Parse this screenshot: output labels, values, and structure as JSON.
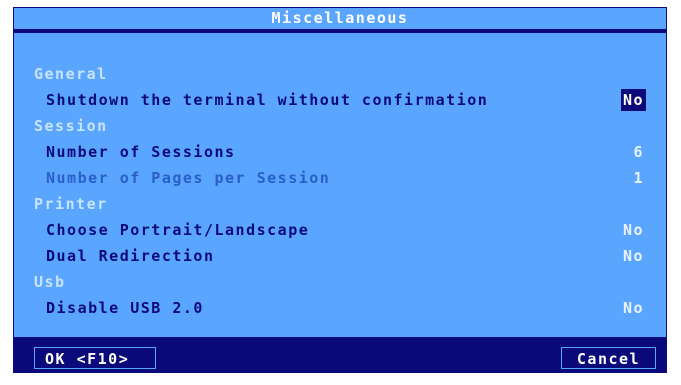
{
  "dialog": {
    "title": "Miscellaneous"
  },
  "sections": {
    "general": "General",
    "session": "Session",
    "printer": "Printer",
    "usb": "Usb"
  },
  "settings": {
    "shutdown_label": "Shutdown the terminal without confirmation",
    "shutdown_value": "No",
    "sessions_label": "Number of Sessions",
    "sessions_value": "6",
    "pages_label": "Number of Pages per Session",
    "pages_value": "1",
    "portrait_label": "Choose Portrait/Landscape",
    "portrait_value": "No",
    "dual_label": "Dual Redirection",
    "dual_value": "No",
    "usb_label": "Disable USB 2.0",
    "usb_value": "No"
  },
  "buttons": {
    "ok_label": "OK <F10>",
    "cancel_label": "Cancel"
  },
  "colors": {
    "panel": "#5aa6ff",
    "frame": "#0a0a7a"
  }
}
